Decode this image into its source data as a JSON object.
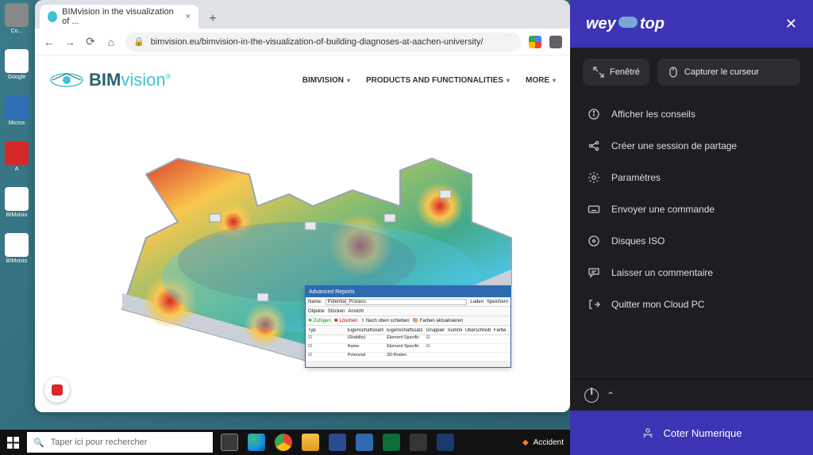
{
  "desktop": {
    "icons": [
      "Co...",
      "Google",
      "Micros",
      "A",
      "BIMvisio",
      "BIMvisio"
    ]
  },
  "browser": {
    "tab_title": "BIMvision in the visualization of ...",
    "url": "bimvision.eu/bimvision-in-the-visualization-of-building-diagnoses-at-aachen-university/",
    "logo_brand": "BIM",
    "logo_word": "vision",
    "logo_reg": "®",
    "menu": {
      "m1": "BIMVISION",
      "m2": "PRODUCTS AND FUNCTIONALITIES",
      "m3": "MORE"
    },
    "reports": {
      "title": "Advanced Reports",
      "name_label": "Name:",
      "name_value": "Potential_Process",
      "btn_laden": "Laden",
      "btn_speichern": "Speichern",
      "tab1": "Objekte",
      "tab2": "Stücken",
      "tab3": "Ansicht",
      "tool_add": "Zufügen",
      "tool_del": "Löschen",
      "tool_move": "Nach oben schieben",
      "tool_color": "Farben aktualisieren",
      "col0": "Typ",
      "col1": "Eigenschaftsname",
      "col2": "Eigenschaftssatz",
      "col3": "Gruppieren",
      "col4": "Summe",
      "col5": "Überschreiben beim Verbinden",
      "col6": "Farbe",
      "r0a": "(Stability)",
      "r0b": "Element Specific",
      "r1a": "Name",
      "r1b": "Element Specific",
      "r2a": "Potenzial",
      "r2b": "3D-Boden"
    }
  },
  "weytop": {
    "brand_a": "wey",
    "brand_b": "top",
    "btn_windowed": "Fenêtré",
    "btn_capture": "Capturer le curseur",
    "items": {
      "i0": "Afficher les conseils",
      "i1": "Créer une session de partage",
      "i2": "Paramètres",
      "i3": "Envoyer une commande",
      "i4": "Disques ISO",
      "i5": "Laisser un commentaire",
      "i6": "Quitter mon Cloud PC"
    },
    "bottom": "Coter Numerique"
  },
  "taskbar": {
    "search_placeholder": "Taper ici pour rechercher",
    "accident": "Accident"
  }
}
